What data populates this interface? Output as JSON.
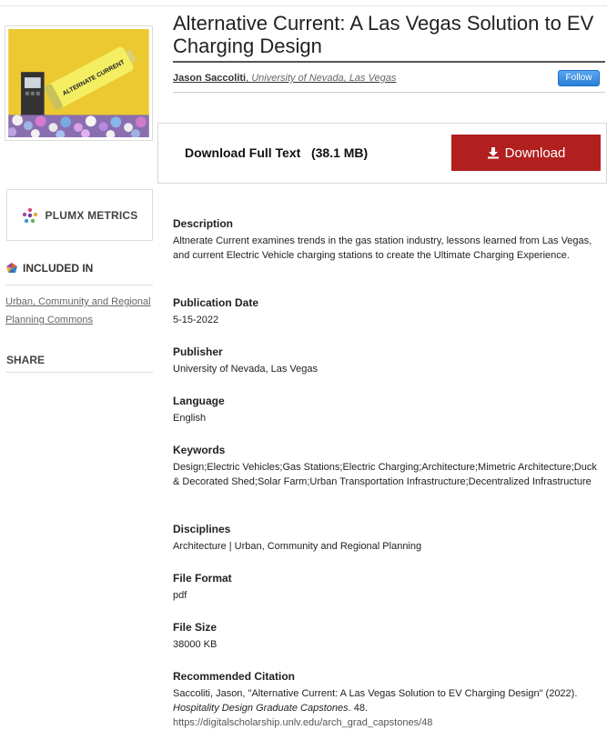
{
  "title": "Alternative Current: A Las Vegas Solution to EV Charging Design",
  "author": {
    "name": "Jason Saccoliti",
    "affiliation": "University of Nevada, Las Vegas",
    "separator": ", "
  },
  "follow_label": "Follow",
  "download": {
    "label_text": "Download Full Text",
    "size": "(38.1 MB)",
    "button_label": "Download"
  },
  "sidebar": {
    "plumx_label": "PLUMX METRICS",
    "included_in_label": "INCLUDED IN",
    "included_in_link": "Urban, Community and Regional Planning Commons",
    "share_label": "SHARE"
  },
  "cover": {
    "can_text": "ALTERNATE CURRENT"
  },
  "sections": {
    "description": {
      "heading": "Description",
      "value": "Altnerate Current examines trends in the gas station industry, lessons learned from Las Vegas, and current Electric Vehicle charging stations to create the Ultimate Charging Experience."
    },
    "publication_date": {
      "heading": "Publication Date",
      "value": "5-15-2022"
    },
    "publisher": {
      "heading": "Publisher",
      "value": "University of Nevada, Las Vegas"
    },
    "language": {
      "heading": "Language",
      "value": "English"
    },
    "keywords": {
      "heading": "Keywords",
      "value": "Design;Electric Vehicles;Gas Stations;Electric Charging;Architecture;Mimetric Architecture;Duck & Decorated Shed;Solar Farm;Urban Transportation Infrastructure;Decentralized Infrastructure"
    },
    "disciplines": {
      "heading": "Disciplines",
      "value": "Architecture | Urban, Community and Regional Planning"
    },
    "file_format": {
      "heading": "File Format",
      "value": "pdf"
    },
    "file_size": {
      "heading": "File Size",
      "value": "38000 KB"
    },
    "citation": {
      "heading": "Recommended Citation",
      "text_before": "Saccoliti, Jason, \"Alternative Current: A Las Vegas Solution to EV Charging Design\" (2022). ",
      "series": "Hospitality Design Graduate Capstones",
      "text_after": ". 48.",
      "url": "https://digitalscholarship.unlv.edu/arch_grad_capstones/48"
    }
  },
  "colors": {
    "download_button": "#b21f1f",
    "follow_button": "#2a7fd6",
    "cover_bg": "#e8c42a"
  }
}
